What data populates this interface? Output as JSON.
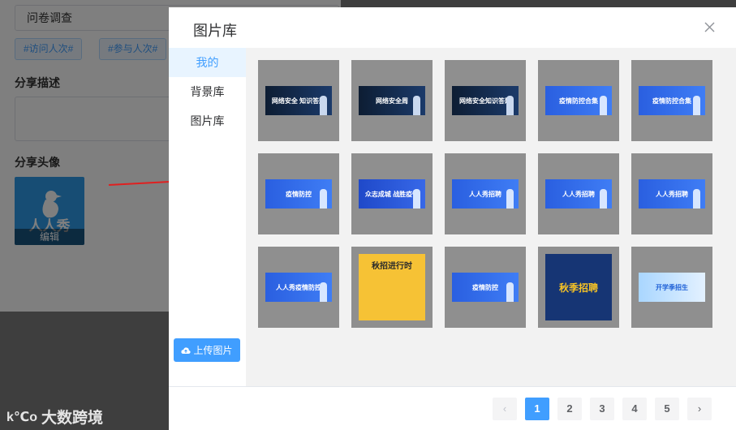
{
  "background": {
    "title_input_value": "问卷调查",
    "tags": [
      "#访问人次#",
      "#参与人次#"
    ],
    "share_desc_label": "分享描述",
    "share_avatar_label": "分享头像",
    "avatar_brand_text": "人人秀",
    "avatar_edit_label": "编辑"
  },
  "watermark": {
    "logo_text": "k℃o",
    "text": "大数跨境"
  },
  "dialog": {
    "title": "图片库",
    "close_icon": "close-icon",
    "sidebar": {
      "items": [
        {
          "label": "我的",
          "active": true
        },
        {
          "label": "背景库",
          "active": false
        },
        {
          "label": "图片库",
          "active": false
        }
      ],
      "upload_label": "上传图片",
      "upload_icon": "cloud-upload-icon"
    },
    "images": [
      {
        "style": "dark",
        "text": "网络安全 知识答题"
      },
      {
        "style": "dark",
        "text": "网络安全周"
      },
      {
        "style": "dark",
        "text": "网络安全知识答题"
      },
      {
        "style": "blue",
        "text": "疫情防控合集"
      },
      {
        "style": "blue",
        "text": "疫情防控合集"
      },
      {
        "style": "blue",
        "text": "疫情防控"
      },
      {
        "style": "blue2",
        "text": "众志成城 战胜疫情"
      },
      {
        "style": "blue",
        "text": "人人秀招聘"
      },
      {
        "style": "blue",
        "text": "人人秀招聘"
      },
      {
        "style": "blue",
        "text": "人人秀招聘"
      },
      {
        "style": "blue",
        "text": "人人秀疫情防控"
      },
      {
        "style": "poster",
        "text": "秋招进行时"
      },
      {
        "style": "blue",
        "text": "疫情防控"
      },
      {
        "style": "poster2",
        "text": "秋季招聘"
      },
      {
        "style": "light",
        "text": "开学季招生"
      }
    ],
    "pagination": {
      "prev": "‹",
      "next": "›",
      "pages": [
        "1",
        "2",
        "3",
        "4",
        "5"
      ],
      "current": "1"
    }
  },
  "colors": {
    "accent": "#409eff",
    "arrow": "#e02020"
  }
}
